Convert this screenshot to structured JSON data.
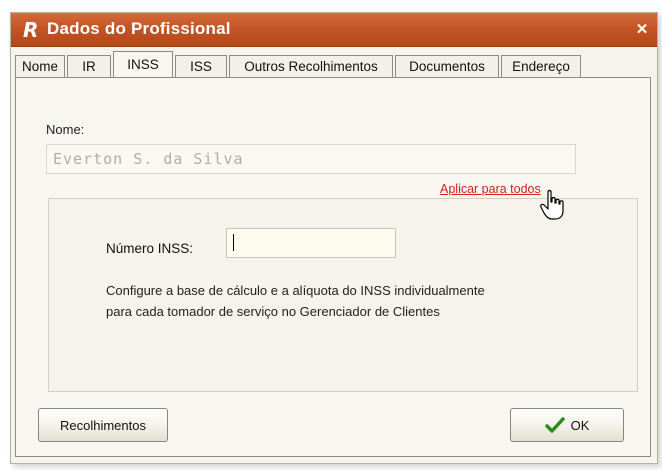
{
  "window": {
    "title": "Dados do Profissional",
    "close_glyph": "✕",
    "app_icon": "r-logo-icon",
    "title_color": "#c35526"
  },
  "tabs": [
    {
      "label": "Nome",
      "active": false
    },
    {
      "label": "IR",
      "active": false
    },
    {
      "label": "INSS",
      "active": true
    },
    {
      "label": "ISS",
      "active": false
    },
    {
      "label": "Outros Recolhimentos",
      "active": false
    },
    {
      "label": "Documentos",
      "active": false
    },
    {
      "label": "Endereço",
      "active": false
    }
  ],
  "form": {
    "nome_label": "Nome:",
    "nome_value": "Everton S. da Silva",
    "apply_link": "Aplicar para todos",
    "inss_label": "Número INSS:",
    "inss_value": "",
    "description": "Configure a base de cálculo e a alíquota do INSS individualmente para cada tomador de serviço no Gerenciador de Clientes"
  },
  "buttons": {
    "recolhimentos": "Recolhimentos",
    "ok": "OK"
  },
  "colors": {
    "link": "#d62020",
    "check": "#2e8b1e"
  }
}
